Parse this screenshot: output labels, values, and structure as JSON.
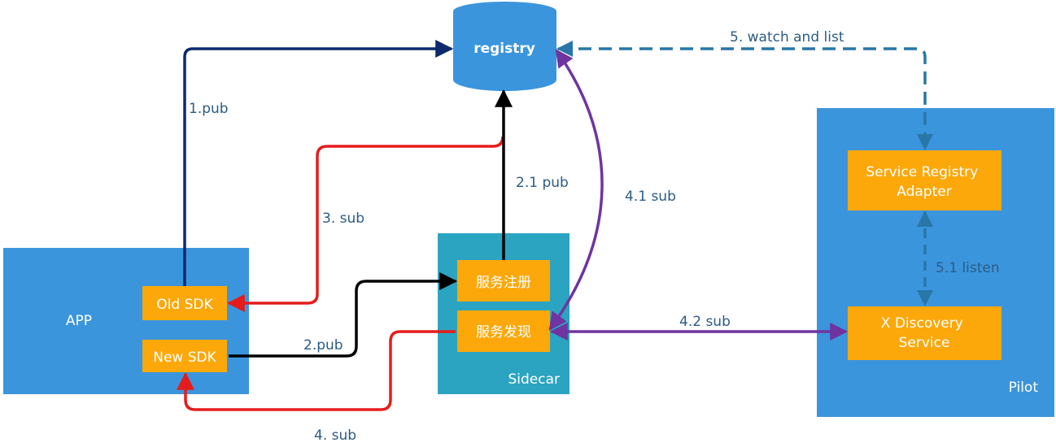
{
  "nodes": {
    "registry": "registry",
    "app": "APP",
    "old_sdk": "Old SDK",
    "new_sdk": "New SDK",
    "sidecar": "Sidecar",
    "service_register": "服务注册",
    "service_discovery": "服务发现",
    "pilot": "Pilot",
    "service_registry_adapter": [
      "Service Registry",
      "Adapter"
    ],
    "x_discovery_service": [
      "X Discovery",
      "Service"
    ]
  },
  "edges": {
    "pub_1": "1.pub",
    "pub_2": "2.pub",
    "pub_2_1": "2.1 pub",
    "sub_3": "3. sub",
    "sub_4": "4. sub",
    "sub_4_1": "4.1 sub",
    "sub_4_2": "4.2 sub",
    "watch_list_5": "5. watch and list",
    "listen_5_1": "5.1 listen"
  },
  "colors": {
    "container_blue": "#3b95dc",
    "sidecar_teal": "#2ba4c1",
    "box_orange": "#fca80a",
    "navy_arrow": "#0d2a6e",
    "red_arrow": "#e51c1c",
    "black_arrow": "#000000",
    "purple_arrow": "#7034a0",
    "dashed_arrow": "#2877a8",
    "label_text": "#2b5c85"
  }
}
